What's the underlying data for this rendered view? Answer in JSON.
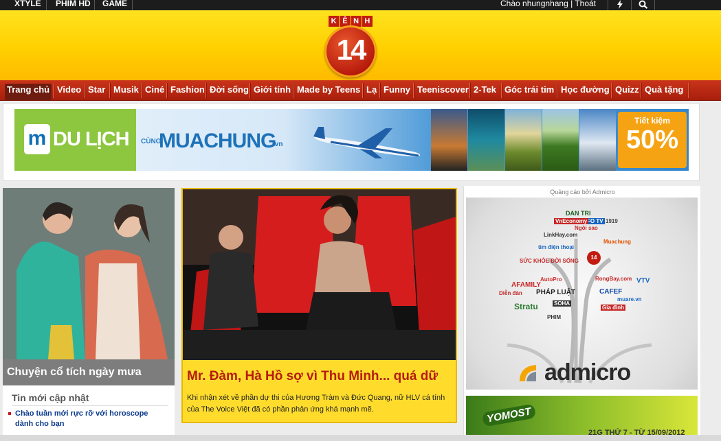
{
  "topbar": {
    "links": [
      "XTYLE",
      "PHIM HD",
      "GAME"
    ],
    "user_text": "Chào nhungnhang | Thoát",
    "icons": [
      "lightning-icon",
      "search-icon"
    ]
  },
  "header": {
    "logo_letters": [
      "K",
      "Ê",
      "N",
      "H"
    ],
    "logo_number": "14"
  },
  "nav": {
    "items": [
      "Trang chủ",
      "Video",
      "Star",
      "Musik",
      "Ciné",
      "Fashion",
      "Đời sống",
      "Giới tính",
      "Made by Teens",
      "Lạ",
      "Funny",
      "Teeniscover",
      "2-Tek",
      "Góc trái tim",
      "Học đường",
      "Quizz",
      "Quà tặng"
    ],
    "active_index": 0
  },
  "banner": {
    "dulich": "DU LỊCH",
    "cung": "CÙNG",
    "muachung": "MUACHUNG",
    "vn": ".vn",
    "badge_top": "Tiết kiệm",
    "badge_value": "50%"
  },
  "left": {
    "caption": "Chuyện cổ tích ngày mưa",
    "news_heading": "Tin mới cập nhật",
    "news": [
      "Chào tuần mới rực rỡ với horoscope dành cho bạn"
    ]
  },
  "featured": {
    "title": "Mr. Đàm, Hà Hồ sợ vì Thu Minh... quá dữ",
    "description": "Khi nhận xét về phần dự thi của Hương Tràm và Đức Quang, nữ HLV cá tính của The Voice Việt đã có phần phản ứng khá mạnh mẽ."
  },
  "ad": {
    "label": "Quảng cáo bởi Admicro",
    "brand_word": "admicro",
    "brands": [
      "DAN TRI",
      "INFO TV",
      "1919",
      "VnEconomy",
      "Ngôi sao",
      "LinkHay.com",
      "tim điện thoại",
      "SỨC KHỎE ĐỜI SỐNG",
      "14",
      "Muachung",
      "AFAMILY",
      "AutoPro",
      "RongBay.com",
      "VTV",
      "CAFEF",
      "Diễn đàn",
      "PHÁP LUẬT",
      "muare.vn",
      "Stratu",
      "Gia đình",
      "PHIM",
      "SOHA"
    ],
    "ad2_brand": "YOMOST",
    "ad2_date": "21G THỨ 7 - TỪ 15/09/2012"
  },
  "colors": {
    "topbar": "#1c1c1c",
    "header_yellow": "#ffd000",
    "nav_red": "#b8260f",
    "featured_yellow": "#ffdc2c",
    "headline_red": "#b51d0c",
    "link_blue": "#0a3a8c"
  }
}
